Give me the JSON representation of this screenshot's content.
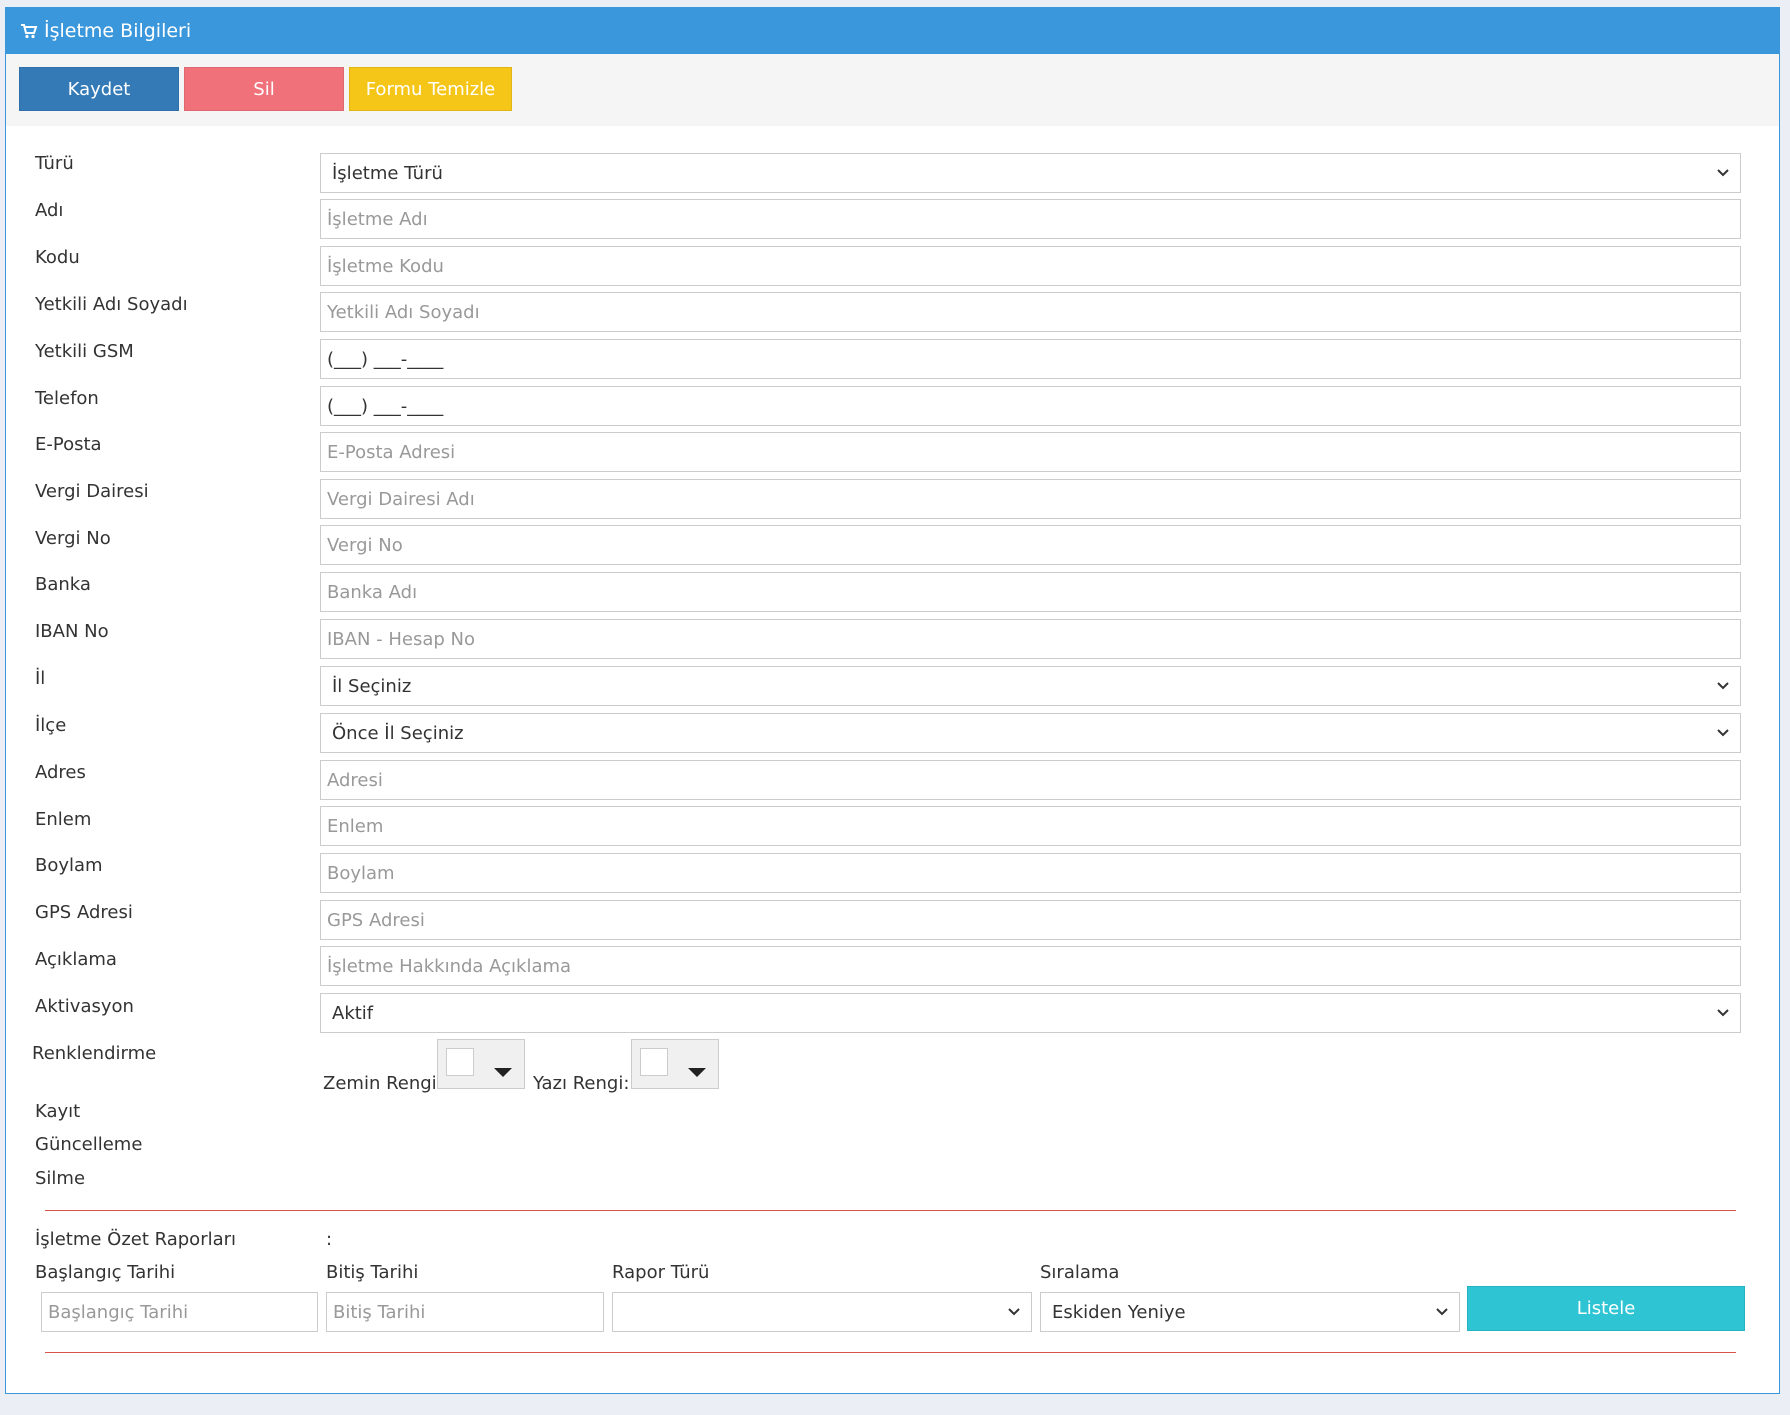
{
  "header": {
    "title": "İşletme Bilgileri",
    "icon": "cart-icon"
  },
  "toolbar": {
    "save": "Kaydet",
    "delete": "Sil",
    "clear": "Formu Temizle"
  },
  "form": {
    "turu": {
      "label": "Türü",
      "value": "İşletme Türü"
    },
    "adi": {
      "label": "Adı",
      "placeholder": "İşletme Adı"
    },
    "kodu": {
      "label": "Kodu",
      "placeholder": "İşletme Kodu"
    },
    "yetkili": {
      "label": "Yetkili Adı Soyadı",
      "placeholder": "Yetkili Adı Soyadı"
    },
    "gsm": {
      "label": "Yetkili GSM",
      "value": "(___) ___-____"
    },
    "telefon": {
      "label": "Telefon",
      "value": "(___) ___-____"
    },
    "eposta": {
      "label": "E-Posta",
      "placeholder": "E-Posta Adresi"
    },
    "vergi_dairesi": {
      "label": "Vergi Dairesi",
      "placeholder": "Vergi Dairesi Adı"
    },
    "vergi_no": {
      "label": "Vergi No",
      "placeholder": "Vergi No"
    },
    "banka": {
      "label": "Banka",
      "placeholder": "Banka Adı"
    },
    "iban": {
      "label": "IBAN No",
      "placeholder": "IBAN - Hesap No"
    },
    "il": {
      "label": "İl",
      "value": "İl Seçiniz"
    },
    "ilce": {
      "label": "İlçe",
      "value": "Önce İl Seçiniz"
    },
    "adres": {
      "label": "Adres",
      "placeholder": "Adresi"
    },
    "enlem": {
      "label": "Enlem",
      "placeholder": "Enlem"
    },
    "boylam": {
      "label": "Boylam",
      "placeholder": "Boylam"
    },
    "gps": {
      "label": "GPS Adresi",
      "placeholder": "GPS Adresi"
    },
    "aciklama": {
      "label": "Açıklama",
      "placeholder": "İşletme Hakkında Açıklama"
    },
    "aktivasyon": {
      "label": "Aktivasyon",
      "value": "Aktif"
    },
    "renk": {
      "label": "Renklendirme",
      "zemin": "Zemin Rengi:",
      "yazi": "Yazı Rengi:"
    },
    "kayit": "Kayıt",
    "guncelleme": "Güncelleme",
    "silme": "Silme"
  },
  "report": {
    "title": "İşletme Özet Raporları",
    "colon": ":",
    "start_label": "Başlangıç Tarihi",
    "start_placeholder": "Başlangıç Tarihi",
    "end_label": "Bitiş Tarihi",
    "end_placeholder": "Bitiş Tarihi",
    "type_label": "Rapor Türü",
    "type_value": "",
    "sort_label": "Sıralama",
    "sort_value": "Eskiden Yeniye",
    "list_button": "Listele"
  },
  "colors": {
    "primary": "#3a97db",
    "save": "#337ab7",
    "delete": "#f0717a",
    "clear": "#f5c518",
    "list": "#2ec4d4",
    "divider": "#d9534f"
  }
}
